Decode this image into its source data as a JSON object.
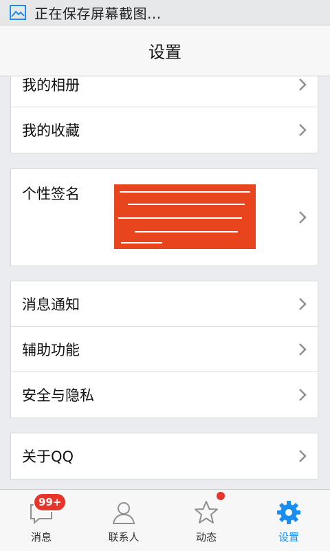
{
  "status_bar": {
    "text": "正在保存屏幕截图...",
    "icon": "picture-icon"
  },
  "header": {
    "title": "设置"
  },
  "groups": [
    {
      "items": [
        {
          "label": "我的相册"
        },
        {
          "label": "我的收藏"
        }
      ]
    },
    {
      "items": [
        {
          "label": "个性签名",
          "value_redacted": true
        }
      ]
    },
    {
      "items": [
        {
          "label": "消息通知"
        },
        {
          "label": "辅助功能"
        },
        {
          "label": "安全与隐私"
        }
      ]
    },
    {
      "items": [
        {
          "label": "关于QQ"
        }
      ]
    }
  ],
  "tabbar": {
    "tabs": [
      {
        "label": "消息",
        "icon": "chat-bubble-icon",
        "badge": "99+"
      },
      {
        "label": "联系人",
        "icon": "person-icon"
      },
      {
        "label": "动态",
        "icon": "star-icon",
        "has_dot": true
      },
      {
        "label": "设置",
        "icon": "gear-icon",
        "active": true
      }
    ]
  },
  "colors": {
    "accent": "#1a8ef0",
    "badge": "#e8352b",
    "redaction": "#e8451f"
  }
}
